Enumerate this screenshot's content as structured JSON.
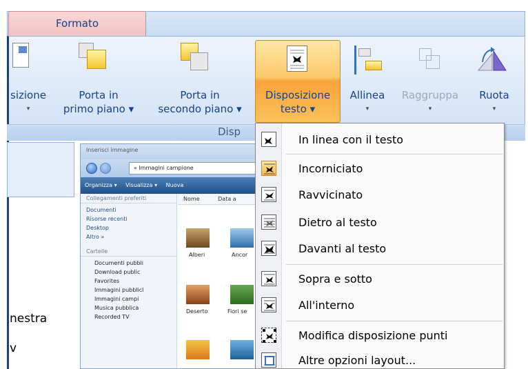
{
  "ribbon": {
    "tab_label": "Formato",
    "group_label": "Disp",
    "buttons": [
      {
        "line1": "sizione",
        "line2": "▾"
      },
      {
        "line1": "Porta in",
        "line2": "primo piano ▾"
      },
      {
        "line1": "Porta in",
        "line2": "secondo piano ▾"
      },
      {
        "line1": "Disposizione",
        "line2": "testo ▾"
      },
      {
        "line1": "Allinea",
        "line2": "▾"
      },
      {
        "line1": "Raggruppa",
        "line2": "▾"
      },
      {
        "line1": "Ruota",
        "line2": "▾"
      }
    ]
  },
  "left_pane": {
    "text1": "nestra",
    "text2": "v"
  },
  "explorer": {
    "title": "Inserisci immagine",
    "path": "« Immagini campione",
    "toolbar": [
      "Organizza ▾",
      "Visualizza ▾",
      "Nuova"
    ],
    "sidebar_header": "Collegamenti preferiti",
    "favorites": [
      "Documenti",
      "Risorse recenti",
      "Desktop",
      "Altro »"
    ],
    "folders_header": "Cartelle",
    "folders": [
      "Documenti pubbli",
      "Download public",
      "Favorites",
      "Immagini pubblicl",
      "Immagini campi",
      "Musica pubblica",
      "Recorded TV"
    ],
    "columns": [
      "Nome",
      "Data a"
    ],
    "thumbs": [
      "Alberi",
      "Ancor",
      "Deserto",
      "Fiori se"
    ]
  },
  "menu": {
    "items": [
      {
        "label": "In linea con il testo"
      },
      {
        "label": "Incorniciato"
      },
      {
        "label": "Ravvicinato"
      },
      {
        "label": "Dietro al testo"
      },
      {
        "label": "Davanti al testo"
      },
      {
        "label": "Sopra e sotto"
      },
      {
        "label": "All'interno"
      },
      {
        "label": "Modifica disposizione punti"
      },
      {
        "label": "Altre opzioni layout..."
      }
    ]
  },
  "colors": {
    "accent": "#f9a43b",
    "ribbon_text": "#15428b",
    "tab_active": "#f2c2c2"
  }
}
